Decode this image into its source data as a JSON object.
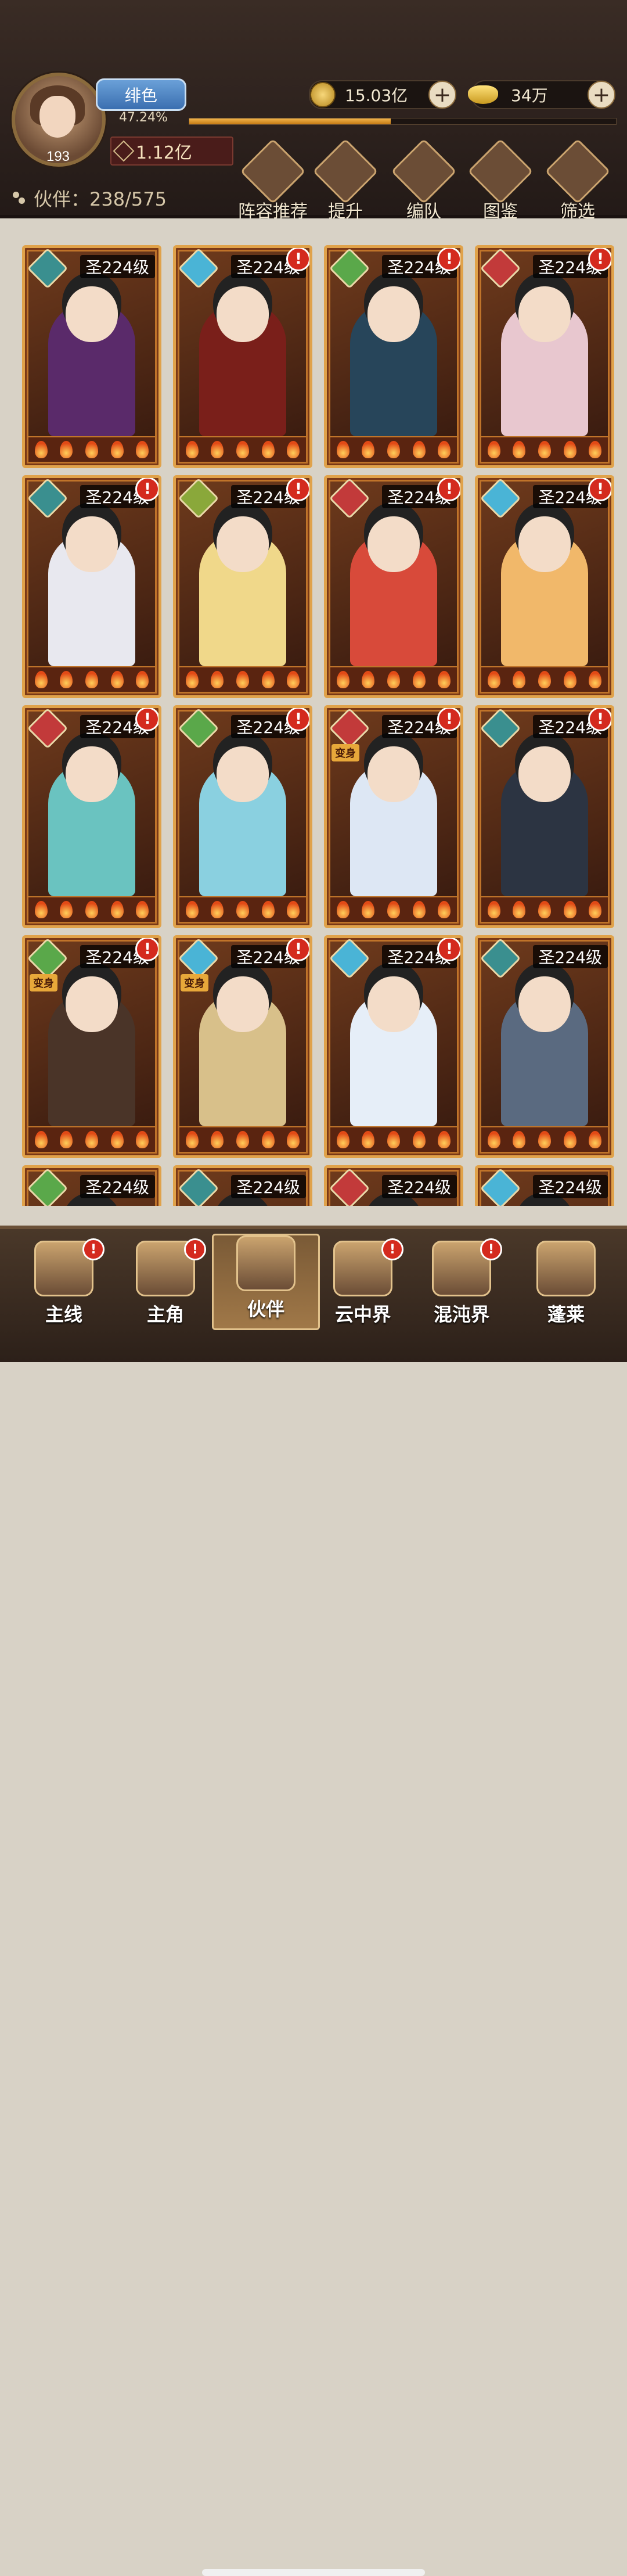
{
  "player": {
    "level": "193",
    "vip_label": "绯色",
    "exp_percent_text": "47.24%",
    "exp_fraction": 0.4724,
    "power": "1.12亿"
  },
  "currencies": {
    "coins": "15.03亿",
    "ingots": "34万"
  },
  "partners": {
    "label": "伙伴：238/575"
  },
  "menu": [
    {
      "label": "阵容推荐",
      "icon": "lineup-recommend-icon"
    },
    {
      "label": "提升",
      "icon": "upgrade-icon"
    },
    {
      "label": "编队",
      "icon": "formation-flag-icon"
    },
    {
      "label": "图鉴",
      "icon": "codex-scroll-icon"
    },
    {
      "label": "筛选",
      "icon": "filter-icon"
    }
  ],
  "cards": [
    {
      "level": "圣224级",
      "alert": false,
      "tag": "",
      "elem_color": "#3a8f8f",
      "bg": "#5a2a6a"
    },
    {
      "level": "圣224级",
      "alert": true,
      "tag": "",
      "elem_color": "#4ab4d6",
      "bg": "#7a1f1a"
    },
    {
      "level": "圣224级",
      "alert": true,
      "tag": "",
      "elem_color": "#5aa84a",
      "bg": "#27455a"
    },
    {
      "level": "圣224级",
      "alert": true,
      "tag": "",
      "elem_color": "#c23a3a",
      "bg": "#e8c7cf"
    },
    {
      "level": "圣224级",
      "alert": true,
      "tag": "",
      "elem_color": "#3a8f8f",
      "bg": "#e8e8ef"
    },
    {
      "level": "圣224级",
      "alert": true,
      "tag": "",
      "elem_color": "#8aa83a",
      "bg": "#f0d88a"
    },
    {
      "level": "圣224级",
      "alert": true,
      "tag": "",
      "elem_color": "#c23a3a",
      "bg": "#d84a3a"
    },
    {
      "level": "圣224级",
      "alert": true,
      "tag": "",
      "elem_color": "#4ab4d6",
      "bg": "#f1b86a"
    },
    {
      "level": "圣224级",
      "alert": true,
      "tag": "",
      "elem_color": "#c23a3a",
      "bg": "#6ac3c0"
    },
    {
      "level": "圣224级",
      "alert": true,
      "tag": "",
      "elem_color": "#5aa84a",
      "bg": "#8ad0e0"
    },
    {
      "level": "圣224级",
      "alert": true,
      "tag": "变身",
      "elem_color": "#c23a3a",
      "bg": "#dde7f4"
    },
    {
      "level": "圣224级",
      "alert": true,
      "tag": "",
      "elem_color": "#3a8f8f",
      "bg": "#2c3442"
    },
    {
      "level": "圣224级",
      "alert": true,
      "tag": "变身",
      "elem_color": "#5aa84a",
      "bg": "#4a3428"
    },
    {
      "level": "圣224级",
      "alert": true,
      "tag": "变身",
      "elem_color": "#4ab4d6",
      "bg": "#d8c08a"
    },
    {
      "level": "圣224级",
      "alert": true,
      "tag": "",
      "elem_color": "#4ab4d6",
      "bg": "#e6eef8"
    },
    {
      "level": "圣224级",
      "alert": false,
      "tag": "",
      "elem_color": "#3a8f8f",
      "bg": "#5a6a80"
    },
    {
      "level": "圣224级",
      "alert": false,
      "tag": "",
      "elem_color": "#5aa84a",
      "bg": "#3a2a1a"
    },
    {
      "level": "圣224级",
      "alert": false,
      "tag": "",
      "elem_color": "#3a8f8f",
      "bg": "#3a2a1a"
    },
    {
      "level": "圣224级",
      "alert": false,
      "tag": "",
      "elem_color": "#c23a3a",
      "bg": "#3a2a1a"
    },
    {
      "level": "圣224级",
      "alert": false,
      "tag": "",
      "elem_color": "#4ab4d6",
      "bg": "#3a2a1a"
    }
  ],
  "nav": [
    {
      "label": "主线",
      "alert": true,
      "active": false
    },
    {
      "label": "主角",
      "alert": true,
      "active": false
    },
    {
      "label": "伙伴",
      "alert": false,
      "active": true
    },
    {
      "label": "云中界",
      "alert": true,
      "active": false
    },
    {
      "label": "混沌界",
      "alert": true,
      "active": false
    },
    {
      "label": "蓬莱",
      "alert": false,
      "active": false
    }
  ]
}
